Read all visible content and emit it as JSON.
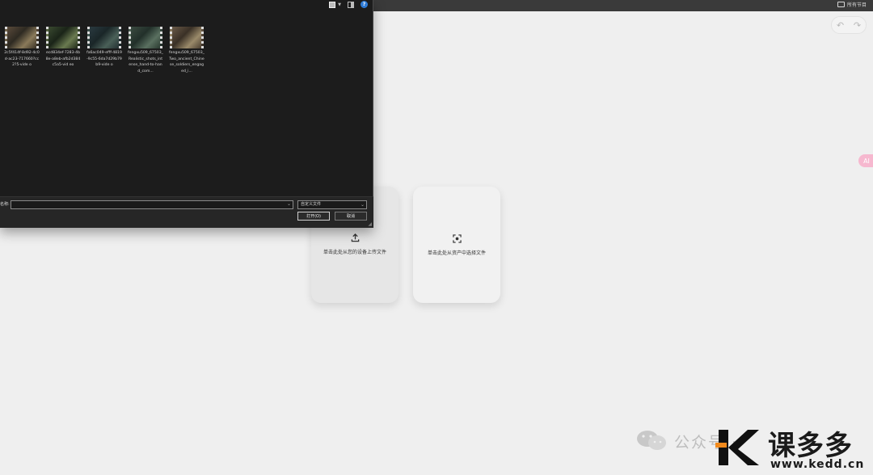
{
  "topbar": {
    "right_label": "所有节目"
  },
  "undo_redo": {
    "undo_icon": "↶",
    "redo_icon": "↷"
  },
  "float_widget": {
    "label": "AI"
  },
  "cards": {
    "local": {
      "label": "单击此处从您的设备上传文件",
      "icon": "upload-icon"
    },
    "asset": {
      "label": "单击此处从资产中选择文件",
      "icon": "asset-select-icon"
    }
  },
  "dialog": {
    "files": [
      {
        "name": "2c5f414f-8d92-4c0d-ac23-717660?cc2?5-vide o"
      },
      {
        "name": "ecd834ef-7283-4b8e-a8eb-afb2d384c5a5-vid eo"
      },
      {
        "name": "fa6ac049-efff-4819-9c55-6da7d29b79b9-vide o"
      },
      {
        "name": "fengxu509_67503_Realistic_shots_intense_hand-to-hand_com..."
      },
      {
        "name": "fengxu509_67503_Two_ancient_Chinese_soldiers_engaged_i..."
      }
    ],
    "filename_label": "名称:",
    "filename_value": "",
    "filetype_value": "自定义文件",
    "open_button": "打开(O)",
    "cancel_button": "取消"
  },
  "watermark": {
    "gzh": "公众号 · ",
    "brand": "课多多",
    "domain": "www.kedd.cn"
  }
}
